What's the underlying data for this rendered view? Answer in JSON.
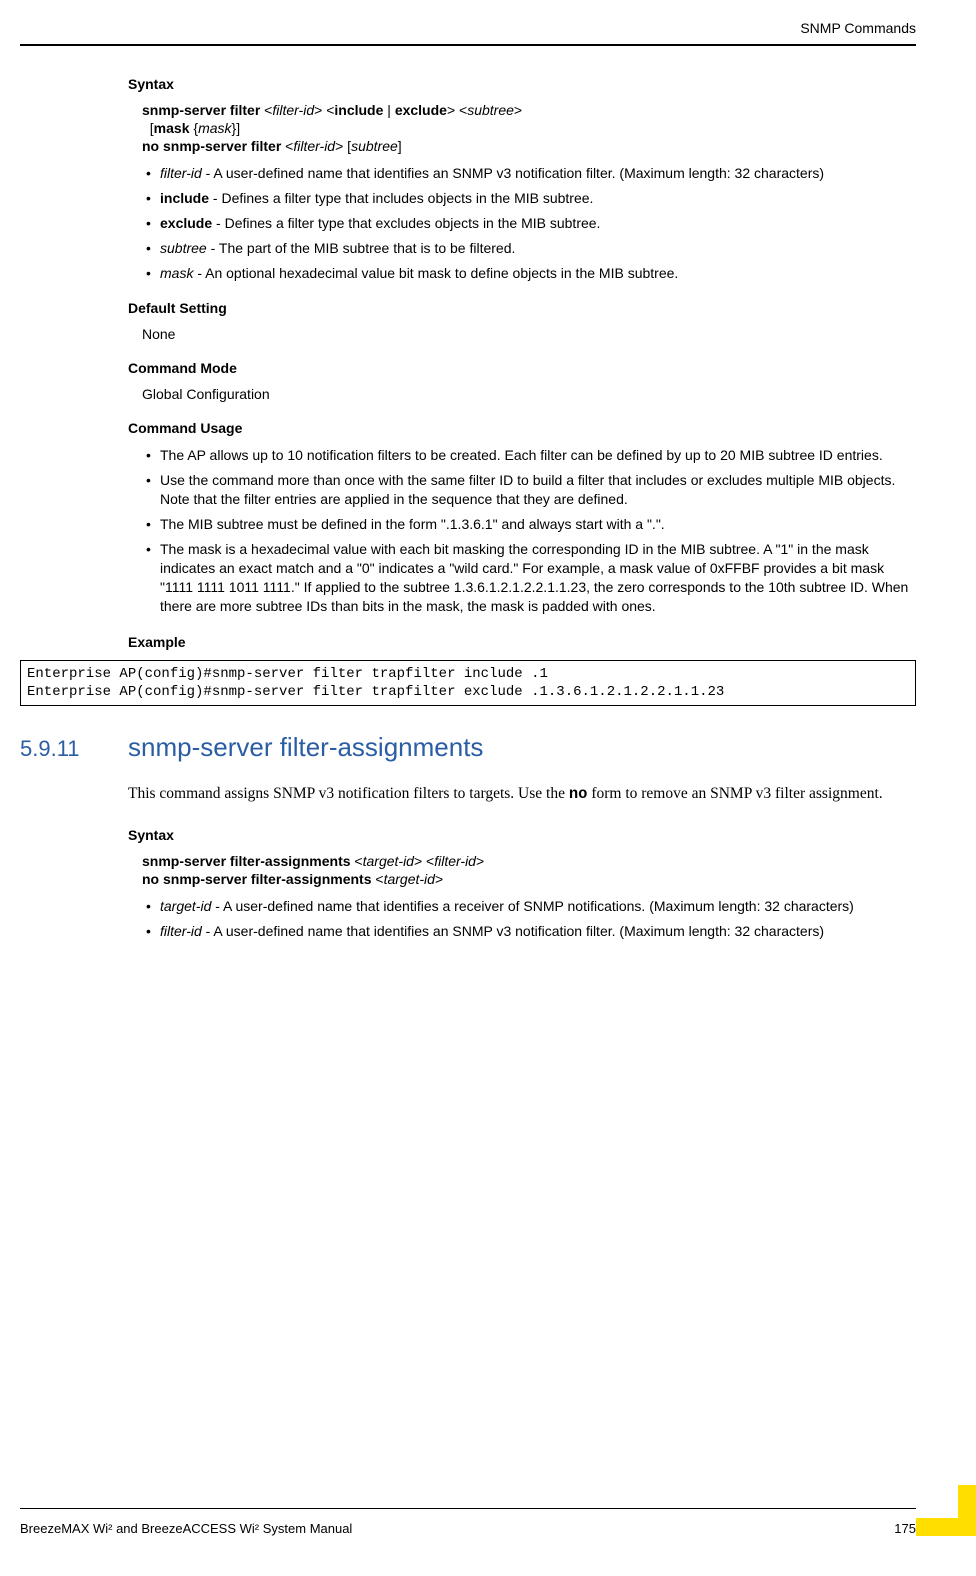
{
  "header": {
    "title": "SNMP Commands"
  },
  "section1": {
    "syntax_heading": "Syntax",
    "syntax_line1_parts": {
      "p1": "snmp-server filter",
      "p2": " <",
      "p3": "filter-id",
      "p4": "> <",
      "p5": "include",
      "p6": " | ",
      "p7": "exclude",
      "p8": "> <",
      "p9": "subtree",
      "p10": ">"
    },
    "syntax_line2_parts": {
      "p1": "  [",
      "p2": "mask",
      "p3": " {",
      "p4": "mask",
      "p5": "}]"
    },
    "syntax_line3_parts": {
      "p1": "no snmp-server filter",
      "p2": " <",
      "p3": "filter-id",
      "p4": "> [",
      "p5": "subtree",
      "p6": "]"
    },
    "bullets1": [
      {
        "term": "filter-id",
        "desc": " - A user-defined name that identifies an SNMP v3 notification filter. (Maximum length: 32 characters)",
        "italic": true
      },
      {
        "term": "include",
        "desc": " - Defines a filter type that includes objects in the MIB subtree.",
        "italic": false
      },
      {
        "term": "exclude",
        "desc": " - Defines a filter type that excludes objects in the MIB subtree.",
        "italic": false
      },
      {
        "term": "subtree",
        "desc": " - The part of the MIB subtree that is to be filtered.",
        "italic": true
      },
      {
        "term": "mask",
        "desc": " - An optional hexadecimal value bit mask to define objects in the MIB subtree.",
        "italic": true
      }
    ],
    "default_heading": "Default Setting",
    "default_value": "None",
    "mode_heading": "Command Mode",
    "mode_value": "Global Configuration",
    "usage_heading": "Command Usage",
    "usage_bullets": [
      "The AP allows up to 10 notification filters to be created. Each filter can be defined by up to 20 MIB subtree ID entries.",
      "Use the command more than once with the same filter ID to build a filter that includes or excludes multiple MIB objects. Note that the filter entries are applied in the sequence that they are defined.",
      "The MIB subtree must be defined in the form \".1.3.6.1\" and always start with a \".\".",
      "The mask is a hexadecimal value with each bit masking the corresponding ID in the MIB subtree. A \"1\" in the mask indicates an exact match and a \"0\" indicates a \"wild card.\" For example, a mask value of 0xFFBF provides a bit mask \"1111 1111 1011 1111.\" If applied to the subtree 1.3.6.1.2.1.2.2.1.1.23, the zero corresponds to the 10th subtree ID. When there are more subtree IDs than bits in the mask, the mask is padded with ones."
    ],
    "example_heading": "Example",
    "example_code": "Enterprise AP(config)#snmp-server filter trapfilter include .1\nEnterprise AP(config)#snmp-server filter trapfilter exclude .1.3.6.1.2.1.2.2.1.1.23"
  },
  "section2": {
    "number": "5.9.11",
    "title": "snmp-server filter-assignments",
    "paragraph_parts": {
      "p1": "This command assigns SNMP v3 notification filters to targets. Use the ",
      "p2": "no",
      "p3": " form to remove an SNMP v3 filter assignment."
    },
    "syntax_heading": "Syntax",
    "syntax_line1_parts": {
      "p1": "snmp-server filter-assignments",
      "p2": " <",
      "p3": "target-id",
      "p4": "> <",
      "p5": "filter-id",
      "p6": ">"
    },
    "syntax_line2_parts": {
      "p1": "no snmp-server filter-assignments",
      "p2": " <",
      "p3": "target-id",
      "p4": ">"
    },
    "bullets": [
      {
        "term": "target-id",
        "desc": " - A user-defined name that identifies a receiver of SNMP notifications. (Maximum length: 32 characters)"
      },
      {
        "term": "filter-id",
        "desc": " - A user-defined name that identifies an SNMP v3 notification filter. (Maximum length: 32 characters)"
      }
    ]
  },
  "footer": {
    "left": "BreezeMAX Wi² and BreezeACCESS Wi² System Manual",
    "right": "175"
  }
}
